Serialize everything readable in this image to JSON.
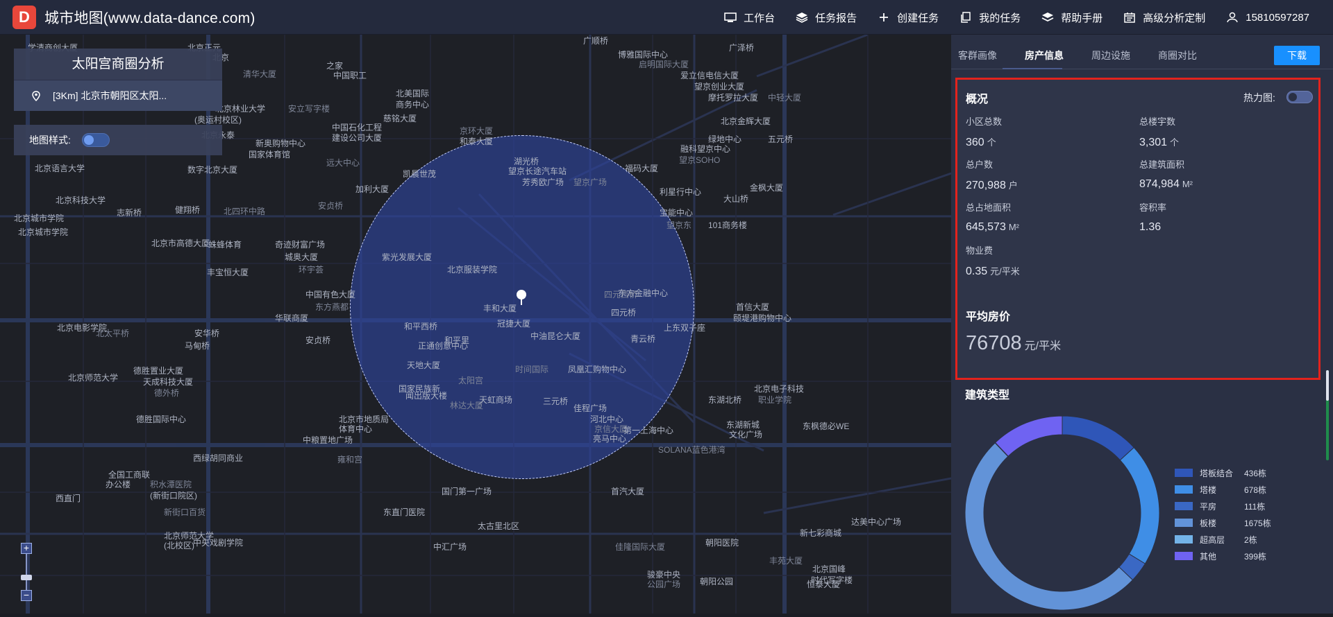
{
  "app": {
    "logo_text": "D",
    "title": "城市地图(www.data-dance.com)"
  },
  "nav": [
    {
      "icon": "monitor-icon",
      "label": "工作台"
    },
    {
      "icon": "layers-icon",
      "label": "任务报告"
    },
    {
      "icon": "plus-icon",
      "label": "创建任务"
    },
    {
      "icon": "copy-icon",
      "label": "我的任务"
    },
    {
      "icon": "stack-icon",
      "label": "帮助手册"
    },
    {
      "icon": "calendar-icon",
      "label": "高级分析定制"
    },
    {
      "icon": "user-icon",
      "label": "15810597287"
    }
  ],
  "area": {
    "title": "太阳宫商圈分析",
    "address": "[3Km] 北京市朝阳区太阳..."
  },
  "map_style": {
    "label": "地图样式:",
    "enabled": true
  },
  "zoom": {
    "in": "+",
    "out": "−"
  },
  "map": {
    "radius": "3Km",
    "pois": [
      "学清商创大厦",
      "北京正元",
      "北京",
      "清华大厦",
      "中国职工",
      "之家",
      "广顺桥",
      "博雅国际中心",
      "启明国际大厦",
      "广泽桥",
      "北美国际",
      "商务中心",
      "慈铭大厦",
      "安立写字楼",
      "北京林业大学",
      "(奥运村校区)",
      "中国石化工程",
      "建设公司大厦",
      "京环大厦",
      "和泰大厦",
      "北京永泰",
      "新奥购物中心",
      "国家体育馆",
      "远大中心",
      "数字北京大厦",
      "北京语言大学",
      "凯晨世茂",
      "加利大厦",
      "安贞桥",
      "北京科技大学",
      "湖光桥",
      "望京长途汽车站",
      "芳秀欧广场",
      "望京广场",
      "福码大厦",
      "利星行中心",
      "金枫大厦",
      "宝能中心",
      "望京东",
      "101商务楼",
      "爱立信电信大厦",
      "望京创业大厦",
      "摩托罗拉大厦",
      "中轻大厦",
      "北京金辉大厦",
      "绿地中心",
      "五元桥",
      "融科望京中心",
      "望京SOHO",
      "大山桥",
      "北京城市学院",
      "志新桥",
      "健翔桥",
      "北四环中路",
      "北京市高德大厦",
      "蛛蜂体育",
      "奇迹财富广场",
      "城奥大厦",
      "环宇荟",
      "丰宝恒大厦",
      "紫光发展大厦",
      "北京服装学院",
      "中国有色大厦",
      "东方燕都",
      "华联商厦",
      "安贞桥",
      "和平西桥",
      "和平里",
      "太阳宫",
      "正通创意中心",
      "丰和大厦",
      "冠捷大厦",
      "中油昆仑大厦",
      "四元西桥",
      "东方金融中心",
      "四元桥",
      "上东双子座",
      "青云桥",
      "时间国际",
      "凤凰汇购物中心",
      "天地大厦",
      "国家民族新",
      "闻出版大楼",
      "林达大厦",
      "天虹商场",
      "三元桥",
      "佳程广场",
      "河北中心",
      "京信大厦",
      "亮马中心",
      "首信大厦",
      "颐堤港购物中心",
      "北京电子科技",
      "职业学院",
      "东湖北桥",
      "东湖新城",
      "文化广场",
      "东枫德必WE",
      "SOLANA蓝色港湾",
      "第一上海中心",
      "北京城市学院",
      "安华桥",
      "马甸桥",
      "北太平桥",
      "北京电影学院",
      "北京师范大学",
      "德胜置业大厦",
      "天成科技大厦",
      "德外桥",
      "德胜国际中心",
      "北京市地质局",
      "体育中心",
      "中粮置地广场",
      "雍和宫",
      "西绿胡同商业",
      "全国工商联",
      "办公楼",
      "西直门",
      "积水潭医院",
      "(新街口院区)",
      "北京师范大学",
      "(北校区)",
      "中央戏剧学院",
      "新街口百货",
      "国门第一广场",
      "东直门医院",
      "中汇广场",
      "太古里北区",
      "佳隆国际大厦",
      "朝阳医院",
      "新七彩商城",
      "达美中心广场",
      "朝阳公园",
      "丰苑大厦",
      "恒泰大厦",
      "北京国峰",
      "时代写字楼",
      "骏豪中央",
      "公园广场",
      "首汽大厦"
    ]
  },
  "tabs": [
    {
      "label": "客群画像",
      "active": false
    },
    {
      "label": "房产信息",
      "active": true
    },
    {
      "label": "周边设施",
      "active": false
    },
    {
      "label": "商圈对比",
      "active": false
    }
  ],
  "download_label": "下载",
  "overview": {
    "title": "概况",
    "heatmap_label": "热力图:",
    "heatmap_enabled": false,
    "stats": [
      {
        "label": "小区总数",
        "value": "360",
        "unit": "个"
      },
      {
        "label": "总楼宇数",
        "value": "3,301",
        "unit": "个"
      },
      {
        "label": "总户数",
        "value": "270,988",
        "unit": "户"
      },
      {
        "label": "总建筑面积",
        "value": "874,984",
        "unit": "M²"
      },
      {
        "label": "总占地面积",
        "value": "645,573",
        "unit": "M²"
      },
      {
        "label": "容积率",
        "value": "1.36",
        "unit": ""
      },
      {
        "label": "物业费",
        "value": "0.35",
        "unit": "元/平米"
      }
    ],
    "avg_price_title": "平均房价",
    "avg_price_value": "76708",
    "avg_price_unit": "元/平米"
  },
  "building_types": {
    "title": "建筑类型",
    "colors": {
      "塔板结合": "#2f56b8",
      "塔楼": "#3f8ee6",
      "平房": "#3a68c4",
      "板楼": "#6293d8",
      "超高层": "#73b3e8",
      "其他": "#6f63f2"
    }
  },
  "chart_data": {
    "type": "pie",
    "title": "建筑类型",
    "categories": [
      "塔板结合",
      "塔楼",
      "平房",
      "板楼",
      "超高层",
      "其他"
    ],
    "values": [
      436,
      678,
      111,
      1675,
      2,
      399
    ],
    "value_labels": [
      "436栋",
      "678栋",
      "111栋",
      "1675栋",
      "2栋",
      "399栋"
    ],
    "donut": true,
    "legend": "right"
  }
}
